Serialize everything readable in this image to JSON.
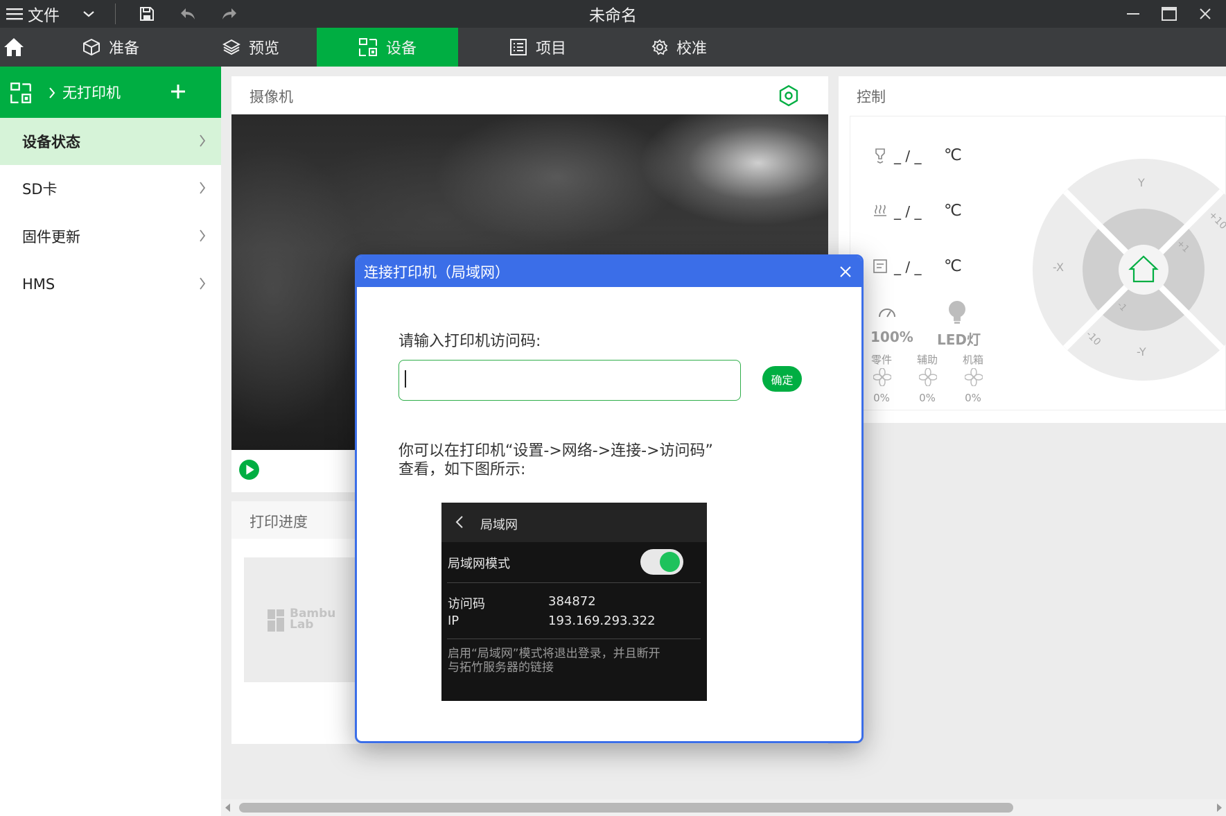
{
  "titlebar": {
    "menu_label": "文件",
    "title": "未命名"
  },
  "tabs": [
    {
      "label": "准备",
      "icon": "cube-icon"
    },
    {
      "label": "预览",
      "icon": "layers-icon"
    },
    {
      "label": "设备",
      "icon": "device-icon",
      "active": true
    },
    {
      "label": "项目",
      "icon": "list-icon"
    },
    {
      "label": "校准",
      "icon": "gear-icon"
    }
  ],
  "sidebar": {
    "printer_label": "无打印机",
    "items": [
      {
        "label": "设备状态",
        "active": true
      },
      {
        "label": "SD卡"
      },
      {
        "label": "固件更新"
      },
      {
        "label": "HMS"
      }
    ]
  },
  "camera": {
    "title": "摄像机"
  },
  "progress": {
    "title": "打印进度",
    "logo_text_1": "Bambu",
    "logo_text_2": "Lab"
  },
  "control": {
    "title": "控制",
    "temps": [
      {
        "icon": "nozzle-icon",
        "value": "_ / _",
        "unit": "℃"
      },
      {
        "icon": "bed-heat-icon",
        "value": "_ / _",
        "unit": "℃"
      },
      {
        "icon": "chamber-icon",
        "value": "_ / _",
        "unit": "℃"
      }
    ],
    "speed": "100%",
    "led": "LED灯",
    "fans": [
      {
        "label": "零件",
        "value": "0%"
      },
      {
        "label": "辅助",
        "value": "0%"
      },
      {
        "label": "机箱",
        "value": "0%"
      }
    ],
    "jog": {
      "y_plus": "Y",
      "y_minus": "-Y",
      "x_minus": "-X",
      "plus10": "+10",
      "plus1": "+1",
      "minus1": "-1",
      "minus10": "-10"
    }
  },
  "dialog": {
    "title": "连接打印机（局域网）",
    "prompt": "请输入打印机访问码:",
    "input_value": "",
    "confirm_label": "确定",
    "help_line1": "你可以在打印机“设置->网络->连接->访问码”",
    "help_line2": "查看，如下图所示:",
    "phone": {
      "header": "局域网",
      "lan_mode_label": "局域网模式",
      "access_code_label": "访问码",
      "access_code_value": "384872",
      "ip_label": "IP",
      "ip_value": "193.169.293.322",
      "note_line1": "启用“局域网”模式将退出登录，并且断开",
      "note_line2": "与拓竹服务器的链接"
    }
  },
  "colors": {
    "accent": "#00ae42",
    "dialog_blue": "#3b6ee8",
    "titlebar": "#2f3133",
    "tabbar": "#3b3d3f"
  }
}
